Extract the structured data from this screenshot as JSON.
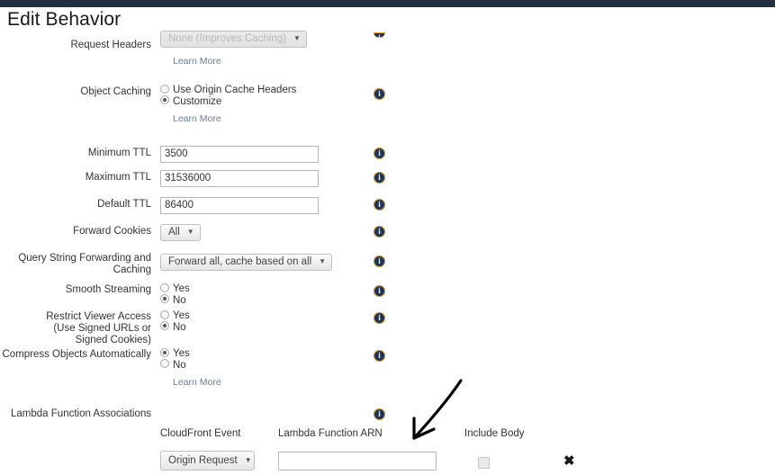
{
  "page": {
    "title": "Edit Behavior",
    "header_color": "#232f3e",
    "info_icon": "info-icon",
    "learn_more_label": "Learn More"
  },
  "fields": {
    "request_headers": {
      "label": "Request Headers",
      "value": "None (Improves Caching)",
      "learn_more": "Learn More"
    },
    "object_caching": {
      "label": "Object Caching",
      "options": [
        {
          "label": "Use Origin Cache Headers",
          "selected": false
        },
        {
          "label": "Customize",
          "selected": true
        }
      ],
      "learn_more": "Learn More"
    },
    "minimum_ttl": {
      "label": "Minimum TTL",
      "value": "3500"
    },
    "maximum_ttl": {
      "label": "Maximum TTL",
      "value": "31536000"
    },
    "default_ttl": {
      "label": "Default TTL",
      "value": "86400"
    },
    "forward_cookies": {
      "label": "Forward Cookies",
      "value": "All"
    },
    "query_string": {
      "label_line1": "Query String Forwarding and",
      "label_line2": "Caching",
      "value": "Forward all, cache based on all"
    },
    "smooth_streaming": {
      "label": "Smooth Streaming",
      "options": [
        {
          "label": "Yes",
          "selected": false
        },
        {
          "label": "No",
          "selected": true
        }
      ]
    },
    "restrict_viewer_access": {
      "label_line1": "Restrict Viewer Access",
      "label_line2": "(Use Signed URLs or",
      "label_line3": "Signed Cookies)",
      "options": [
        {
          "label": "Yes",
          "selected": false
        },
        {
          "label": "No",
          "selected": true
        }
      ]
    },
    "compress_objects": {
      "label": "Compress Objects Automatically",
      "options": [
        {
          "label": "Yes",
          "selected": true
        },
        {
          "label": "No",
          "selected": false
        }
      ],
      "learn_more": "Learn More"
    }
  },
  "lambda": {
    "section_label": "Lambda Function Associations",
    "columns": {
      "event": "CloudFront Event",
      "arn": "Lambda Function ARN",
      "include_body": "Include Body"
    },
    "rows": [
      {
        "event": "Origin Request",
        "arn_value": "",
        "include_body_checked": false,
        "remove_label": "✖"
      }
    ]
  },
  "annotation": {
    "type": "hand-drawn-arrow",
    "color": "#000000",
    "points_to": "lambda-function-arn-input"
  }
}
